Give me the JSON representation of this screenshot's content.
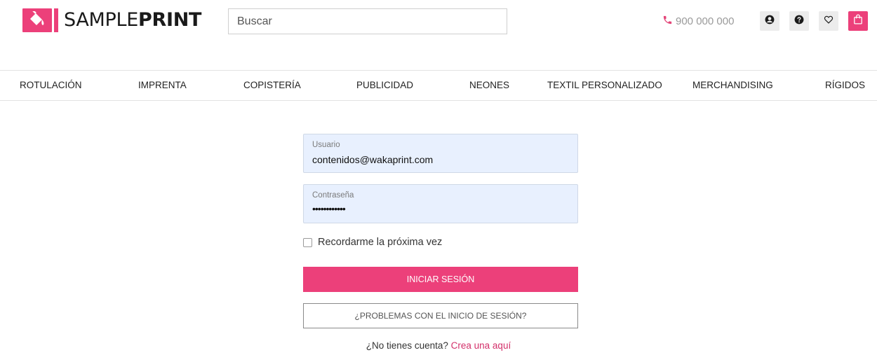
{
  "brand": {
    "name_light": "SAMPLE",
    "name_bold": "PRINT",
    "logo_icon": "paint-bucket-icon",
    "color": "#ec407a"
  },
  "header": {
    "search_placeholder": "Buscar",
    "phone": "900 000 000",
    "phone_icon": "phone-icon",
    "phone_color": "#e34578",
    "buttons": [
      {
        "name": "account",
        "icon": "user-icon"
      },
      {
        "name": "help",
        "icon": "question-icon"
      },
      {
        "name": "wishlist",
        "icon": "heart-icon"
      },
      {
        "name": "cart",
        "icon": "shopping-bag-icon"
      }
    ]
  },
  "nav": {
    "items": [
      {
        "label": "ROTULACIÓN"
      },
      {
        "label": "IMPRENTA"
      },
      {
        "label": "COPISTERÍA"
      },
      {
        "label": "PUBLICIDAD"
      },
      {
        "label": "NEONES"
      },
      {
        "label": "TEXTIL PERSONALIZADO"
      },
      {
        "label": "MERCHANDISING"
      },
      {
        "label": "RÍGIDOS"
      }
    ]
  },
  "login": {
    "user_label": "Usuario",
    "user_value": "contenidos@wakaprint.com",
    "password_label": "Contraseña",
    "password_value": "••••••••••••",
    "remember_label": "Recordarme la próxima vez",
    "remember_checked": false,
    "submit_label": "INICIAR SESIÓN",
    "problems_label": "¿PROBLEMAS CON EL INICIO DE SESIÓN?",
    "no_account_text": "¿No tienes cuenta?",
    "create_link": "Crea una aquí",
    "field_bg": "#e8f0fe"
  }
}
